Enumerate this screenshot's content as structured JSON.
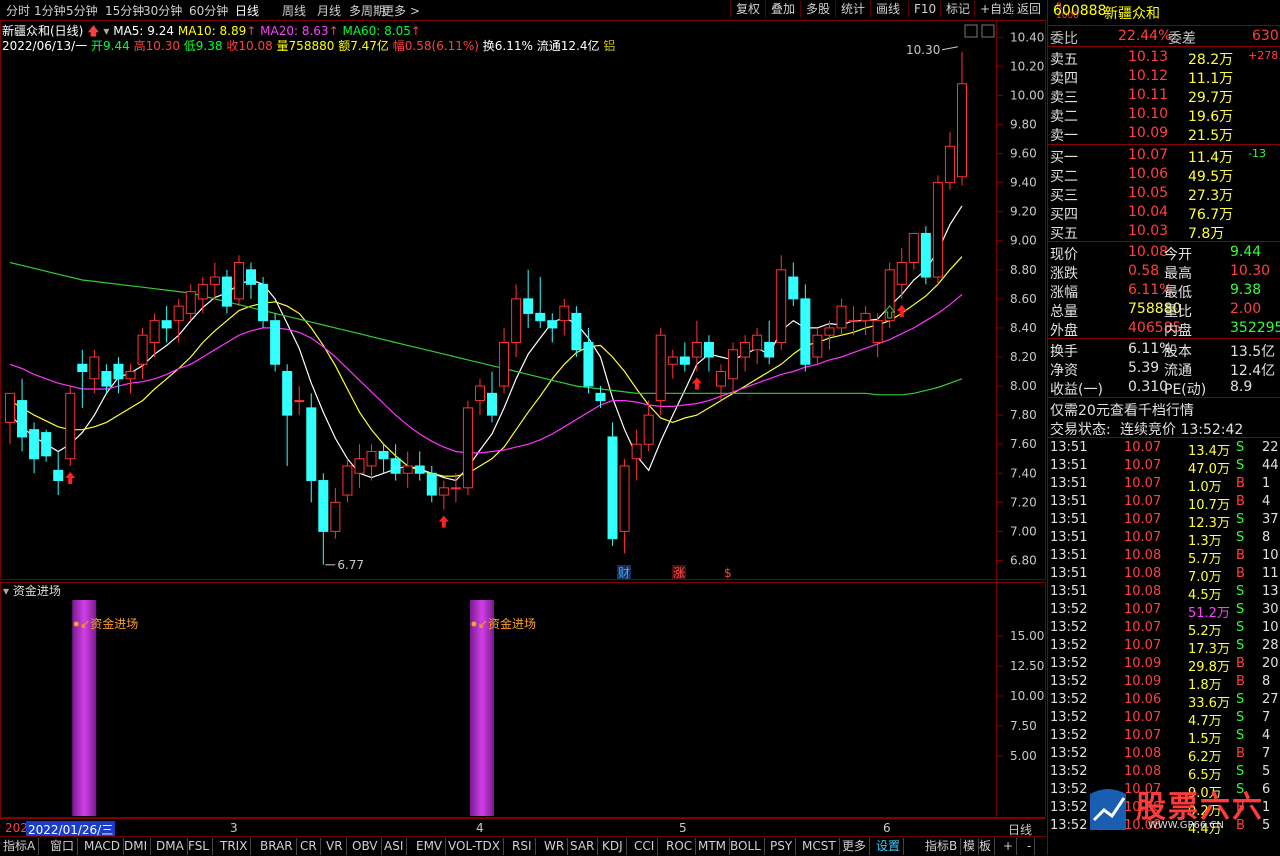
{
  "toolbar": {
    "left": [
      "分时",
      "1分钟",
      "5分钟",
      "15分钟",
      "30分钟",
      "60分钟",
      "日线",
      "周线",
      "月线",
      "多周期",
      "更多 >"
    ],
    "active": "日线",
    "right": [
      "复权",
      "叠加",
      "多股",
      "统计",
      "画线",
      "F10",
      "标记",
      "+自选",
      "返回"
    ]
  },
  "info": {
    "title": "新疆众和(日线)",
    "ma5": "MA5: 9.24",
    "ma10": "MA10: 8.89",
    "ma20": "MA20: 8.63",
    "ma60": "MA60: 8.05",
    "date": "2022/06/13/一",
    "open": "开9.44",
    "high": "高10.30",
    "low": "低9.38",
    "close": "收10.08",
    "vol": "量758880",
    "amount": "额7.47亿",
    "change": "幅0.58(6.11%)",
    "turnover": "换6.11%",
    "float": "流通12.4亿",
    "tag": "铝"
  },
  "colors": {
    "up": "#ff3333",
    "down": "#33ffff",
    "ma5": "#ffffff",
    "ma10": "#ffff33",
    "ma20": "#ff33ff",
    "ma60": "#33cc33",
    "grid": "#7a0000",
    "indicator_bar": "#b030c8"
  },
  "annotations": {
    "high_label": "10.30",
    "low_label": "6.77",
    "markers": [
      "财",
      "涨",
      "$"
    ]
  },
  "y_axis_main": [
    "10.40",
    "10.20",
    "10.00",
    "9.80",
    "9.60",
    "9.40",
    "9.20",
    "9.00",
    "8.80",
    "8.60",
    "8.40",
    "8.20",
    "8.00",
    "7.80",
    "7.60",
    "7.40",
    "7.20",
    "7.00",
    "6.80"
  ],
  "sub": {
    "title": "资金进场",
    "signal_label": "资金进场",
    "y_axis": [
      "15.00",
      "12.50",
      "10.00",
      "7.50",
      "5.00"
    ]
  },
  "x_axis": {
    "first": "202",
    "cursor_date": "2022/01/26/三",
    "months": [
      "3",
      "4",
      "5",
      "6"
    ],
    "period": "日线"
  },
  "chart_data": {
    "type": "candlestick",
    "ylim": [
      6.7,
      10.45
    ],
    "candles": [
      [
        7.75,
        7.95,
        7.6,
        7.95
      ],
      [
        7.9,
        8.05,
        7.55,
        7.65
      ],
      [
        7.7,
        7.75,
        7.4,
        7.5
      ],
      [
        7.68,
        7.7,
        7.48,
        7.52
      ],
      [
        7.42,
        7.55,
        7.25,
        7.35
      ],
      [
        7.5,
        8.0,
        7.45,
        7.95
      ],
      [
        8.15,
        8.25,
        7.85,
        8.1
      ],
      [
        8.05,
        8.25,
        7.95,
        8.2
      ],
      [
        8.1,
        8.15,
        7.95,
        8.0
      ],
      [
        8.15,
        8.2,
        7.95,
        8.05
      ],
      [
        8.05,
        8.15,
        7.95,
        8.1
      ],
      [
        8.15,
        8.4,
        8.05,
        8.35
      ],
      [
        8.3,
        8.5,
        8.2,
        8.45
      ],
      [
        8.45,
        8.55,
        8.3,
        8.4
      ],
      [
        8.45,
        8.6,
        8.3,
        8.55
      ],
      [
        8.5,
        8.7,
        8.45,
        8.65
      ],
      [
        8.6,
        8.75,
        8.5,
        8.7
      ],
      [
        8.7,
        8.85,
        8.6,
        8.75
      ],
      [
        8.75,
        8.8,
        8.5,
        8.55
      ],
      [
        8.6,
        8.9,
        8.55,
        8.85
      ],
      [
        8.8,
        8.85,
        8.6,
        8.7
      ],
      [
        8.7,
        8.75,
        8.4,
        8.45
      ],
      [
        8.45,
        8.5,
        8.1,
        8.15
      ],
      [
        8.1,
        8.15,
        7.45,
        7.8
      ],
      [
        7.9,
        8.0,
        7.8,
        7.9
      ],
      [
        7.85,
        7.95,
        7.2,
        7.35
      ],
      [
        7.35,
        7.4,
        6.77,
        7.0
      ],
      [
        7.0,
        7.3,
        6.95,
        7.2
      ],
      [
        7.25,
        7.5,
        7.2,
        7.45
      ],
      [
        7.4,
        7.6,
        7.3,
        7.5
      ],
      [
        7.45,
        7.6,
        7.35,
        7.55
      ],
      [
        7.55,
        7.6,
        7.4,
        7.5
      ],
      [
        7.5,
        7.6,
        7.35,
        7.4
      ],
      [
        7.4,
        7.55,
        7.3,
        7.45
      ],
      [
        7.45,
        7.55,
        7.35,
        7.4
      ],
      [
        7.4,
        7.45,
        7.2,
        7.25
      ],
      [
        7.25,
        7.35,
        7.15,
        7.3
      ],
      [
        7.3,
        7.4,
        7.2,
        7.3
      ],
      [
        7.3,
        7.9,
        7.25,
        7.85
      ],
      [
        7.9,
        8.05,
        7.8,
        8.0
      ],
      [
        7.95,
        8.1,
        7.75,
        7.8
      ],
      [
        8.0,
        8.4,
        7.95,
        8.3
      ],
      [
        8.3,
        8.7,
        8.2,
        8.6
      ],
      [
        8.6,
        8.8,
        8.4,
        8.5
      ],
      [
        8.5,
        8.75,
        8.4,
        8.45
      ],
      [
        8.45,
        8.5,
        8.3,
        8.4
      ],
      [
        8.45,
        8.6,
        8.35,
        8.55
      ],
      [
        8.5,
        8.55,
        8.2,
        8.25
      ],
      [
        8.3,
        8.4,
        7.95,
        8.0
      ],
      [
        7.95,
        8.0,
        7.85,
        7.9
      ],
      [
        7.65,
        7.75,
        6.9,
        6.95
      ],
      [
        7.0,
        7.5,
        6.85,
        7.45
      ],
      [
        7.5,
        7.7,
        7.35,
        7.6
      ],
      [
        7.6,
        7.9,
        7.55,
        7.8
      ],
      [
        7.9,
        8.4,
        7.8,
        8.35
      ],
      [
        8.15,
        8.25,
        8.05,
        8.2
      ],
      [
        8.2,
        8.3,
        8.1,
        8.15
      ],
      [
        8.2,
        8.45,
        8.1,
        8.3
      ],
      [
        8.3,
        8.35,
        8.1,
        8.2
      ],
      [
        8.0,
        8.15,
        7.9,
        8.1
      ],
      [
        8.05,
        8.3,
        7.95,
        8.25
      ],
      [
        8.2,
        8.35,
        8.1,
        8.3
      ],
      [
        8.25,
        8.4,
        8.15,
        8.35
      ],
      [
        8.3,
        8.45,
        8.15,
        8.2
      ],
      [
        8.3,
        8.9,
        8.25,
        8.8
      ],
      [
        8.75,
        8.85,
        8.55,
        8.6
      ],
      [
        8.6,
        8.7,
        8.1,
        8.15
      ],
      [
        8.2,
        8.4,
        8.15,
        8.35
      ],
      [
        8.35,
        8.45,
        8.25,
        8.4
      ],
      [
        8.4,
        8.6,
        8.35,
        8.55
      ],
      [
        8.45,
        8.55,
        8.35,
        8.45
      ],
      [
        8.45,
        8.55,
        8.35,
        8.5
      ],
      [
        8.3,
        8.5,
        8.2,
        8.45
      ],
      [
        8.45,
        8.85,
        8.4,
        8.8
      ],
      [
        8.7,
        8.95,
        8.6,
        8.85
      ],
      [
        8.85,
        9.05,
        8.8,
        9.05
      ],
      [
        9.05,
        9.1,
        8.7,
        8.75
      ],
      [
        8.75,
        9.45,
        8.7,
        9.4
      ],
      [
        9.4,
        9.75,
        9.35,
        9.65
      ],
      [
        9.44,
        10.3,
        9.38,
        10.08
      ]
    ],
    "ma_series": [
      {
        "name": "MA5",
        "values": [
          7.8,
          7.72,
          7.65,
          7.6,
          7.55,
          7.6,
          7.68,
          7.8,
          7.95,
          8.06,
          8.09,
          8.14,
          8.22,
          8.28,
          8.35,
          8.45,
          8.54,
          8.61,
          8.64,
          8.7,
          8.73,
          8.7,
          8.6,
          8.43,
          8.26,
          8.02,
          7.82,
          7.64,
          7.5,
          7.4,
          7.37,
          7.4,
          7.43,
          7.45,
          7.43,
          7.4,
          7.37,
          7.35,
          7.44,
          7.56,
          7.67,
          7.85,
          8.05,
          8.22,
          8.33,
          8.44,
          8.47,
          8.43,
          8.33,
          8.2,
          7.92,
          7.7,
          7.52,
          7.42,
          7.62,
          7.8,
          7.97,
          8.15,
          8.22,
          8.2,
          8.18,
          8.22,
          8.26,
          8.22,
          8.38,
          8.45,
          8.4,
          8.4,
          8.43,
          8.42,
          8.45,
          8.45,
          8.46,
          8.55,
          8.63,
          8.73,
          8.8,
          8.93,
          9.11,
          9.24
        ]
      },
      {
        "name": "MA10",
        "values": [
          7.9,
          7.85,
          7.8,
          7.76,
          7.72,
          7.7,
          7.7,
          7.72,
          7.75,
          7.8,
          7.85,
          7.9,
          7.98,
          8.05,
          8.12,
          8.2,
          8.3,
          8.38,
          8.45,
          8.52,
          8.55,
          8.57,
          8.58,
          8.55,
          8.5,
          8.4,
          8.28,
          8.14,
          7.98,
          7.82,
          7.7,
          7.6,
          7.52,
          7.45,
          7.42,
          7.4,
          7.38,
          7.38,
          7.4,
          7.45,
          7.5,
          7.58,
          7.7,
          7.82,
          7.93,
          8.05,
          8.15,
          8.23,
          8.27,
          8.28,
          8.2,
          8.1,
          7.98,
          7.87,
          7.78,
          7.75,
          7.78,
          7.8,
          7.85,
          7.9,
          7.95,
          8.0,
          8.05,
          8.1,
          8.15,
          8.22,
          8.28,
          8.3,
          8.33,
          8.35,
          8.37,
          8.4,
          8.42,
          8.45,
          8.5,
          8.56,
          8.62,
          8.7,
          8.8,
          8.89
        ]
      },
      {
        "name": "MA20",
        "values": [
          8.15,
          8.12,
          8.08,
          8.05,
          8.02,
          8.0,
          7.98,
          7.98,
          7.98,
          8.0,
          8.02,
          8.03,
          8.05,
          8.08,
          8.12,
          8.15,
          8.2,
          8.25,
          8.3,
          8.35,
          8.38,
          8.4,
          8.4,
          8.39,
          8.37,
          8.33,
          8.27,
          8.2,
          8.12,
          8.04,
          7.96,
          7.88,
          7.8,
          7.73,
          7.67,
          7.62,
          7.58,
          7.55,
          7.54,
          7.54,
          7.55,
          7.56,
          7.58,
          7.6,
          7.63,
          7.67,
          7.72,
          7.77,
          7.82,
          7.87,
          7.9,
          7.9,
          7.89,
          7.87,
          7.86,
          7.86,
          7.87,
          7.88,
          7.9,
          7.93,
          7.96,
          7.99,
          8.02,
          8.05,
          8.08,
          8.1,
          8.13,
          8.15,
          8.18,
          8.2,
          8.23,
          8.26,
          8.29,
          8.32,
          8.36,
          8.4,
          8.45,
          8.5,
          8.56,
          8.63
        ]
      },
      {
        "name": "MA60",
        "values": [
          8.85,
          8.83,
          8.81,
          8.79,
          8.77,
          8.75,
          8.73,
          8.72,
          8.71,
          8.7,
          8.69,
          8.68,
          8.67,
          8.66,
          8.65,
          8.64,
          8.62,
          8.6,
          8.58,
          8.56,
          8.54,
          8.52,
          8.5,
          8.48,
          8.46,
          8.44,
          8.42,
          8.4,
          8.38,
          8.36,
          8.34,
          8.32,
          8.3,
          8.28,
          8.26,
          8.24,
          8.22,
          8.2,
          8.18,
          8.16,
          8.14,
          8.12,
          8.1,
          8.08,
          8.06,
          8.04,
          8.02,
          8.0,
          7.99,
          7.98,
          7.97,
          7.96,
          7.95,
          7.95,
          7.95,
          7.95,
          7.95,
          7.95,
          7.95,
          7.95,
          7.95,
          7.95,
          7.95,
          7.95,
          7.95,
          7.95,
          7.95,
          7.95,
          7.95,
          7.95,
          7.95,
          7.95,
          7.94,
          7.94,
          7.94,
          7.95,
          7.97,
          7.99,
          8.02,
          8.05
        ]
      }
    ],
    "buy_signals": [
      5,
      36,
      57,
      74
    ],
    "indicator": {
      "type": "bar",
      "label": "资金进场",
      "bars": [
        5,
        38
      ],
      "value": 18
    },
    "sub_ylim": [
      0,
      18
    ]
  },
  "quote": {
    "code": "600888",
    "name": "新疆众和",
    "wb_label": "委比",
    "wb_value": "22.44%",
    "wc_label": "委差",
    "wc_value": "630",
    "asks": [
      {
        "label": "卖五",
        "price": "10.13",
        "vol": "28.2万",
        "extra": "+278"
      },
      {
        "label": "卖四",
        "price": "10.12",
        "vol": "11.1万",
        "extra": ""
      },
      {
        "label": "卖三",
        "price": "10.11",
        "vol": "29.7万",
        "extra": ""
      },
      {
        "label": "卖二",
        "price": "10.10",
        "vol": "19.6万",
        "extra": ""
      },
      {
        "label": "卖一",
        "price": "10.09",
        "vol": "21.5万",
        "extra": ""
      }
    ],
    "bids": [
      {
        "label": "买一",
        "price": "10.07",
        "vol": "11.4万",
        "extra": "-13"
      },
      {
        "label": "买二",
        "price": "10.06",
        "vol": "49.5万",
        "extra": ""
      },
      {
        "label": "买三",
        "price": "10.05",
        "vol": "27.3万",
        "extra": ""
      },
      {
        "label": "买四",
        "price": "10.04",
        "vol": "76.7万",
        "extra": ""
      },
      {
        "label": "买五",
        "price": "10.03",
        "vol": "7.8万",
        "extra": ""
      }
    ],
    "stats": [
      {
        "l1": "现价",
        "v1": "10.08",
        "l2": "今开",
        "v2": "9.44"
      },
      {
        "l1": "涨跌",
        "v1": "0.58",
        "l2": "最高",
        "v2": "10.30"
      },
      {
        "l1": "涨幅",
        "v1": "6.11%",
        "l2": "最低",
        "v2": "9.38"
      },
      {
        "l1": "总量",
        "v1": "758880",
        "l2": "量比",
        "v2": "2.00"
      },
      {
        "l1": "外盘",
        "v1": "406585",
        "l2": "内盘",
        "v2": "352295"
      }
    ],
    "stats2": [
      {
        "l1": "换手",
        "v1": "6.11%",
        "l2": "股本",
        "v2": "13.5亿"
      },
      {
        "l1": "净资",
        "v1": "5.39",
        "l2": "流通",
        "v2": "12.4亿"
      },
      {
        "l1": "收益(一)",
        "v1": "0.310",
        "l2": "PE(动)",
        "v2": "8.9"
      }
    ],
    "promo": "仅需20元查看千档行情",
    "status_label": "交易状态:",
    "status_value": "连续竞价 13:52:42",
    "ticks": [
      [
        "13:51",
        "10.07",
        "13.4万",
        "S",
        "22"
      ],
      [
        "13:51",
        "10.07",
        "47.0万",
        "S",
        "44"
      ],
      [
        "13:51",
        "10.07",
        "1.0万",
        "B",
        "1"
      ],
      [
        "13:51",
        "10.07",
        "10.7万",
        "B",
        "4"
      ],
      [
        "13:51",
        "10.07",
        "12.3万",
        "S",
        "37"
      ],
      [
        "13:51",
        "10.07",
        "1.3万",
        "S",
        "8"
      ],
      [
        "13:51",
        "10.08",
        "5.7万",
        "B",
        "10"
      ],
      [
        "13:51",
        "10.08",
        "7.0万",
        "B",
        "11"
      ],
      [
        "13:51",
        "10.08",
        "4.5万",
        "S",
        "13"
      ],
      [
        "13:52",
        "10.07",
        "51.2万",
        "S",
        "30"
      ],
      [
        "13:52",
        "10.07",
        "5.2万",
        "S",
        "10"
      ],
      [
        "13:52",
        "10.07",
        "17.3万",
        "S",
        "28"
      ],
      [
        "13:52",
        "10.09",
        "29.8万",
        "B",
        "20"
      ],
      [
        "13:52",
        "10.09",
        "1.8万",
        "B",
        "8"
      ],
      [
        "13:52",
        "10.06",
        "33.6万",
        "S",
        "27"
      ],
      [
        "13:52",
        "10.07",
        "4.7万",
        "S",
        "7"
      ],
      [
        "13:52",
        "10.07",
        "1.5万",
        "S",
        "4"
      ],
      [
        "13:52",
        "10.08",
        "6.2万",
        "B",
        "7"
      ],
      [
        "13:52",
        "10.08",
        "6.5万",
        "S",
        "5"
      ],
      [
        "13:52",
        "10.07",
        "9.0万",
        "S",
        "6"
      ],
      [
        "13:52",
        "10.08",
        "9.2万",
        "B",
        "1"
      ],
      [
        "13:52",
        "10.08",
        "4.4万",
        "B",
        "5"
      ]
    ],
    "watermark": "股票六六",
    "watermark_sub": "WWW.GP66.CN"
  },
  "tabs": [
    "指标A",
    "窗口",
    "MACD",
    "DMI",
    "DMA",
    "FSL",
    "TRIX",
    "BRAR",
    "CR",
    "VR",
    "OBV",
    "ASI",
    "EMV",
    "VOL-TDX",
    "RSI",
    "WR",
    "SAR",
    "KDJ",
    "CCI",
    "ROC",
    "MTM",
    "BOLL",
    "PSY",
    "MCST",
    "更多",
    "设置"
  ],
  "tabs_right": [
    "指标B",
    "模",
    "板",
    "+",
    "-"
  ]
}
